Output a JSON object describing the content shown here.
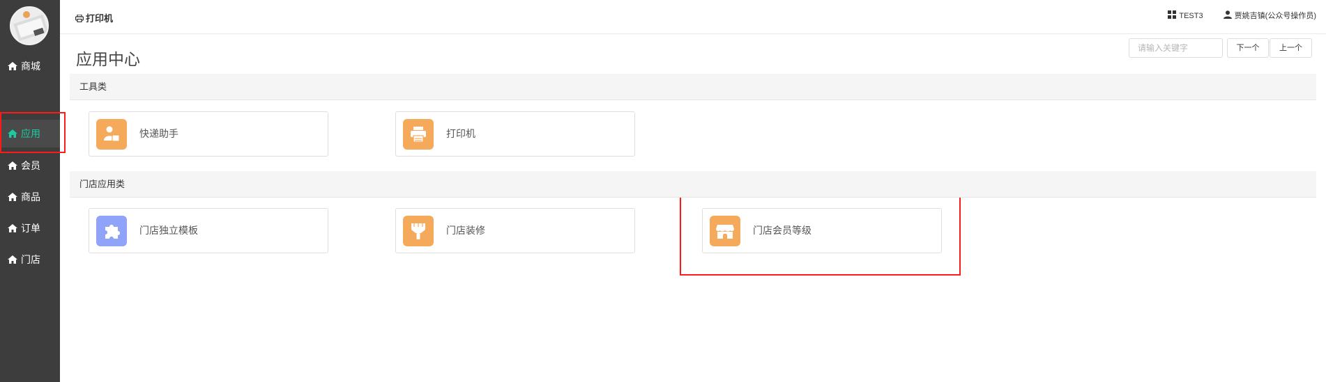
{
  "sidebar": {
    "items": [
      {
        "label": "商城",
        "icon": "home-icon"
      },
      {
        "label": "应用",
        "icon": "home-icon",
        "active": true
      },
      {
        "label": "会员",
        "icon": "home-icon"
      },
      {
        "label": "商品",
        "icon": "home-icon"
      },
      {
        "label": "订单",
        "icon": "home-icon"
      },
      {
        "label": "门店",
        "icon": "home-icon"
      }
    ],
    "active_color": "#1ec8a0"
  },
  "header": {
    "title": "打印机",
    "title_icon": "printer-icon",
    "store": "TEST3",
    "store_icon": "grid-icon",
    "user": "贾姚吉镇(公众号操作员)",
    "user_icon": "user-icon"
  },
  "page": {
    "title": "应用中心",
    "search_placeholder": "请输入关键字",
    "next_label": "下一个",
    "prev_label": "上一个"
  },
  "sections": [
    {
      "title": "工具类",
      "cards": [
        {
          "label": "快递助手",
          "icon": "courier-icon",
          "color": "#f5a95b"
        },
        {
          "label": "打印机",
          "icon": "printer-icon",
          "color": "#f5a95b"
        }
      ]
    },
    {
      "title": "门店应用类",
      "cards": [
        {
          "label": "门店独立模板",
          "icon": "puzzle-icon",
          "color": "#8fa3f8"
        },
        {
          "label": "门店装修",
          "icon": "paint-brush-icon",
          "color": "#f5a95b"
        },
        {
          "label": "门店会员等级",
          "icon": "storefront-icon",
          "color": "#f5a95b"
        }
      ]
    }
  ],
  "annotation_color": "#ff1a1a"
}
